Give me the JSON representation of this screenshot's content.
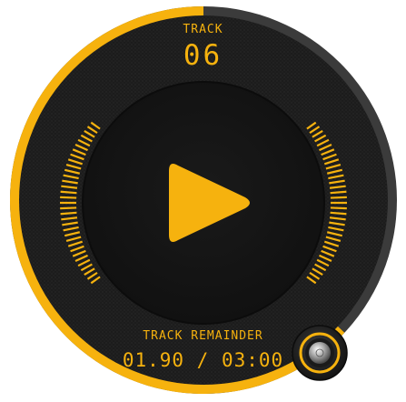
{
  "player": {
    "track_label": "TRACK",
    "track_number": "06",
    "remainder_label": "TRACK REMAINDER",
    "elapsed": "01.90",
    "separator": "/",
    "duration": "03:00",
    "time_display": "01.90 / 03:00",
    "progress_fraction": 0.63
  },
  "controls": {
    "play_icon": "play-icon",
    "knob_icon": "volume-knob-icon"
  },
  "colors": {
    "accent": "#f6b20e",
    "ring_track": "#3b3b3b",
    "face": "#1b1b1b",
    "inner_disc": "#141414"
  }
}
